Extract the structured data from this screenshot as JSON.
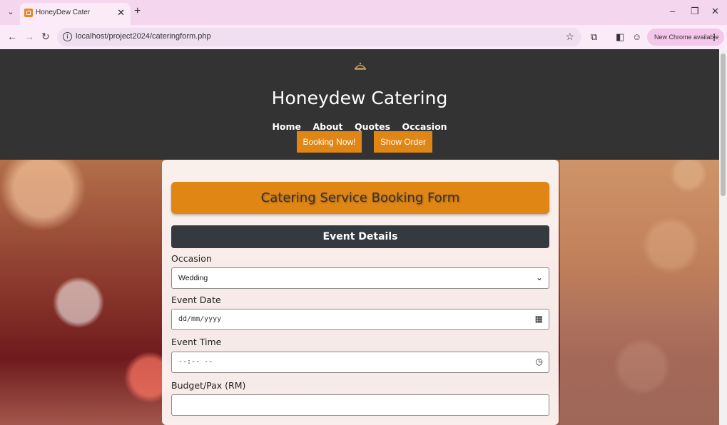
{
  "browser": {
    "tab_title": "HoneyDew Cater",
    "tab_close": "✕",
    "new_tab": "+",
    "url": "localhost/project2024/cateringform.php",
    "update_chip": "New Chrome available",
    "window_controls": {
      "minimize": "–",
      "restore": "❐",
      "close": "✕"
    }
  },
  "site": {
    "title": "Honeydew Catering",
    "nav": [
      "Home",
      "About",
      "Quotes",
      "Occasion"
    ],
    "buttons": {
      "booking": "Booking Now!",
      "show_order": "Show Order"
    }
  },
  "form": {
    "title": "Catering Service Booking Form",
    "section": "Event Details",
    "occasion": {
      "label": "Occasion",
      "value": "Wedding"
    },
    "event_date": {
      "label": "Event Date",
      "placeholder": "dd/mm/yyyy"
    },
    "event_time": {
      "label": "Event Time",
      "placeholder": "--:-- --"
    },
    "budget": {
      "label": "Budget/Pax (RM)",
      "value": ""
    }
  },
  "colors": {
    "accent": "#e08614",
    "header_bg": "#333333",
    "section_bg": "#343a40"
  }
}
